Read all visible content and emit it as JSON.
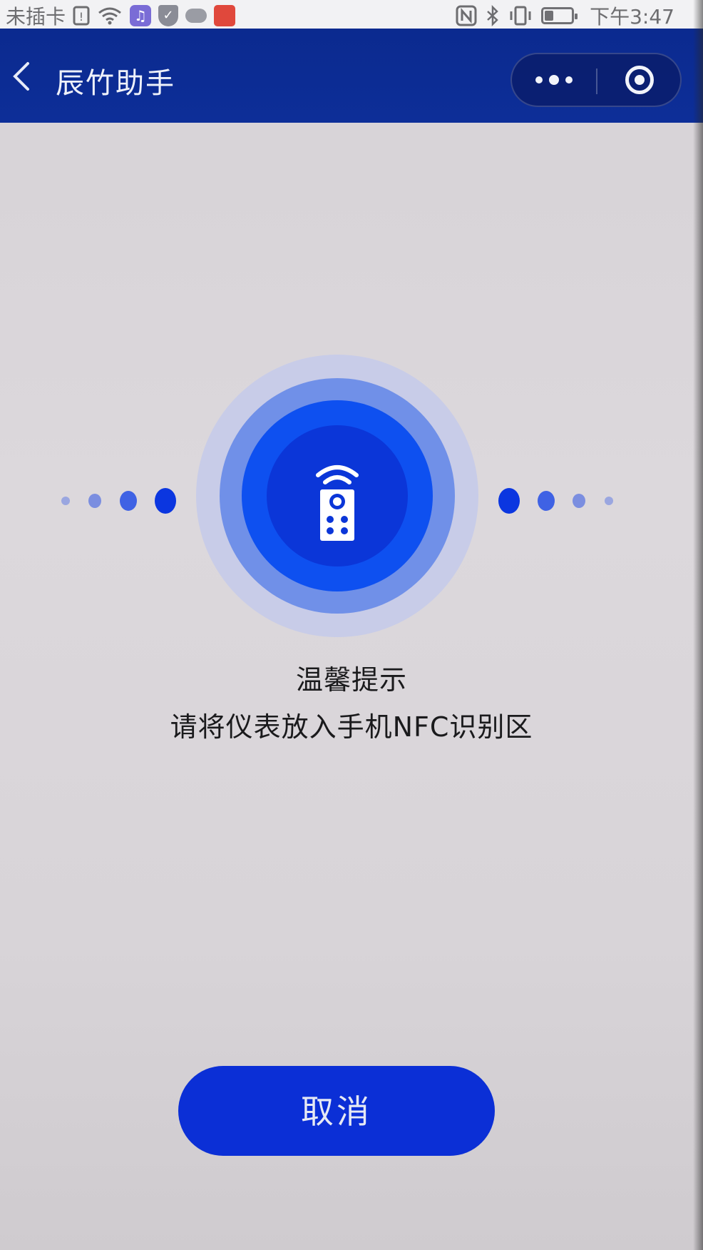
{
  "status_bar": {
    "carrier": "未插卡",
    "time": "下午3:47"
  },
  "header": {
    "back_icon": "chevron-left-icon",
    "title": "辰竹助手",
    "more_icon": "more-dots-icon",
    "close_icon": "target-close-icon"
  },
  "nfc": {
    "icon": "remote-control-icon",
    "colors": {
      "outer": "#c8cce8",
      "middle": "#7090e8",
      "inner": "#0e50f0",
      "core": "#0b36d8"
    }
  },
  "hint": {
    "title": "温馨提示",
    "text": "请将仪表放入手机NFC识别区"
  },
  "cancel_button": {
    "label": "取消"
  },
  "colors": {
    "header_bg": "#0b2a8f",
    "button_bg": "#0b2fd6",
    "page_bg": "#d8d4d8"
  }
}
